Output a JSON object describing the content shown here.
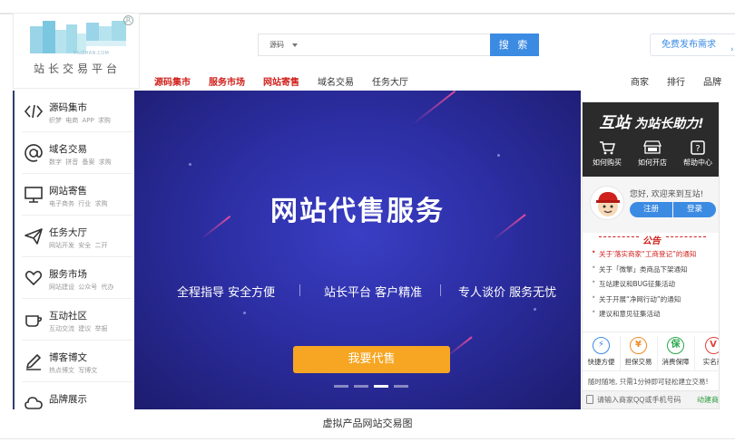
{
  "logo": {
    "domain": "YIUZHAN.COM",
    "tagline": "站长交易平台",
    "registered_mark": "R"
  },
  "search": {
    "type_label": "源码",
    "placeholder": "",
    "button_label": "搜 索"
  },
  "publish_button": "免费发布需求",
  "nav": {
    "left": [
      "源码集市",
      "服务市场",
      "网站寄售",
      "域名交易",
      "任务大厅"
    ],
    "right": [
      "商家",
      "排行",
      "品牌"
    ]
  },
  "sidebar": {
    "items": [
      {
        "title": "源码集市",
        "sub": "织梦 电商 APP 求购",
        "icon": "code-icon"
      },
      {
        "title": "域名交易",
        "sub": "数字 拼音 备案 求购",
        "icon": "at-sign-icon"
      },
      {
        "title": "网站寄售",
        "sub": "电子商务 行业 求购",
        "icon": "monitor-icon"
      },
      {
        "title": "任务大厅",
        "sub": "网站开发 安全 二开",
        "icon": "paper-plane-icon"
      },
      {
        "title": "服务市场",
        "sub": "网站建设 公众号 代办",
        "icon": "heart-hand-icon"
      },
      {
        "title": "互动社区",
        "sub": "互动交流 建议 举报",
        "icon": "coffee-cup-icon"
      },
      {
        "title": "博客博文",
        "sub": "热点博文 写博文",
        "icon": "pen-icon"
      },
      {
        "title": "品牌展示",
        "sub": "",
        "icon": "cloud-icon"
      }
    ]
  },
  "banner": {
    "headline": "网站代售服务",
    "tags": [
      "全程指导 安全方便",
      "站长平台 客户精准",
      "专人谈价 服务无忧"
    ],
    "cta": "我要代售",
    "slides": 4,
    "active_slide": 3
  },
  "panel": {
    "slogan_big": "互站",
    "slogan_rest": "为站长助力!",
    "quick_links": [
      {
        "label": "如何购买",
        "icon": "cart-icon"
      },
      {
        "label": "如何开店",
        "icon": "open-shop-icon"
      },
      {
        "label": "帮助中心",
        "icon": "help-icon"
      }
    ],
    "greeting": "您好, 欢迎来到互站!",
    "register": "注册",
    "login": "登录",
    "notice_title": "公告",
    "notices": [
      {
        "text": "关于'落实商家“工商登记”的通知",
        "hot": true
      },
      {
        "text": "关于「微擎」类商品下架通知",
        "hot": false
      },
      {
        "text": "互站建议和BUG征集活动",
        "hot": false
      },
      {
        "text": "关于开展“净网行动”的通知",
        "hot": false
      },
      {
        "text": "建议和意见征集活动",
        "hot": false
      }
    ],
    "services": [
      {
        "label": "快捷方便",
        "symbol": "⚡",
        "color": "#3c8be3"
      },
      {
        "label": "担保交易",
        "symbol": "¥",
        "color": "#f08a24"
      },
      {
        "label": "消费保障",
        "symbol": "保",
        "color": "#2aa84a"
      },
      {
        "label": "实名商",
        "symbol": "V",
        "color": "#e0413a"
      }
    ],
    "tip": "随时随地, 只需1分钟即可轻松建立交易!",
    "phone_placeholder": "请输入商家QQ或手机号码",
    "phone_button": "动建商"
  },
  "caption": "虚拟产品网站交易图"
}
